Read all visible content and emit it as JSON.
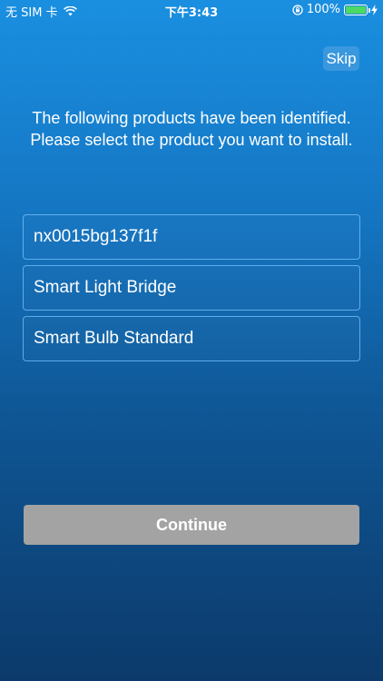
{
  "status_bar": {
    "carrier": "无 SIM 卡",
    "time": "下午3:43",
    "battery_percent": "100%",
    "battery_level": 1.0,
    "battery_color": "#4cd964"
  },
  "header": {
    "skip_label": "Skip"
  },
  "main": {
    "instructions": "The following products have been identified. Please select the product you want to install.",
    "products": [
      {
        "label": "nx0015bg137f1f"
      },
      {
        "label": "Smart Light Bridge"
      },
      {
        "label": "Smart Bulb Standard"
      }
    ],
    "continue_label": "Continue"
  },
  "colors": {
    "gradient_top": "#1a8fe0",
    "gradient_bottom": "#0c3a6b",
    "button_disabled": "#a3a3a3",
    "item_border": "#78c3ff"
  }
}
